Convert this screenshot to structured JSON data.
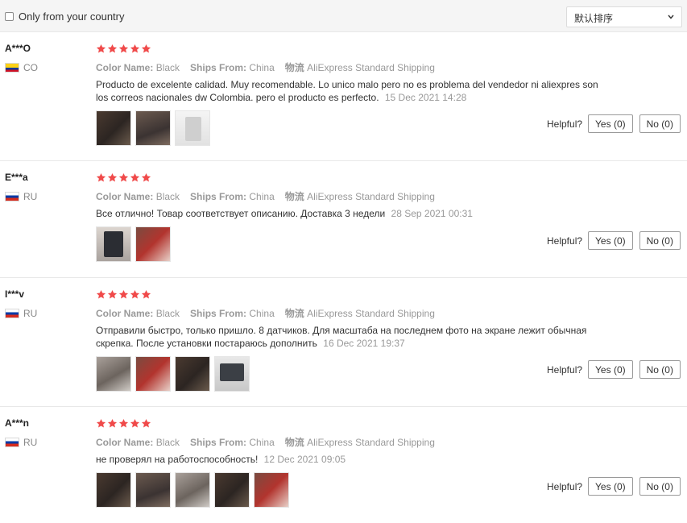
{
  "filter": {
    "country_label": "Only from your country",
    "sort_label": "默认排序"
  },
  "labels": {
    "color_name": "Color Name:",
    "ships_from": "Ships From:",
    "logistics": "物流",
    "helpful": "Helpful?"
  },
  "colors": {
    "star": "#f04a4a",
    "divider": "#e8e8e8",
    "meta_text": "#999999"
  },
  "reviews": [
    {
      "user": "A***O",
      "country": "CO",
      "flag": "colombia-flag",
      "rating": 5,
      "color": "Black",
      "ships_from": "China",
      "shipping": "AliExpress Standard Shipping",
      "text": "Producto de excelente calidad. Muy recomendable. Lo unico malo pero no es problema del vendedor ni aliexpres son los correos nacionales dw Colombia. pero el producto es perfecto.",
      "date": "15 Dec 2021 14:28",
      "yes": "Yes (0)",
      "no": "No (0)"
    },
    {
      "user": "E***a",
      "country": "RU",
      "flag": "russia-flag",
      "rating": 5,
      "color": "Black",
      "ships_from": "China",
      "shipping": "AliExpress Standard Shipping",
      "text": "Все отлично! Товар соответствует описанию. Доставка 3 недели",
      "date": "28 Sep 2021 00:31",
      "yes": "Yes (0)",
      "no": "No (0)"
    },
    {
      "user": "I***v",
      "country": "RU",
      "flag": "russia-flag",
      "rating": 5,
      "color": "Black",
      "ships_from": "China",
      "shipping": "AliExpress Standard Shipping",
      "text": "Отправили быстро, только пришло. 8 датчиков. Для масштаба на последнем фото на экране лежит обычная скрепка. После установки постараюсь дополнить",
      "date": "16 Dec 2021 19:37",
      "yes": "Yes (0)",
      "no": "No (0)"
    },
    {
      "user": "A***n",
      "country": "RU",
      "flag": "russia-flag",
      "rating": 5,
      "color": "Black",
      "ships_from": "China",
      "shipping": "AliExpress Standard Shipping",
      "text": "не проверял на работоспособность!",
      "date": "12 Dec 2021 09:05",
      "yes": "Yes (0)",
      "no": "No (0)"
    }
  ]
}
